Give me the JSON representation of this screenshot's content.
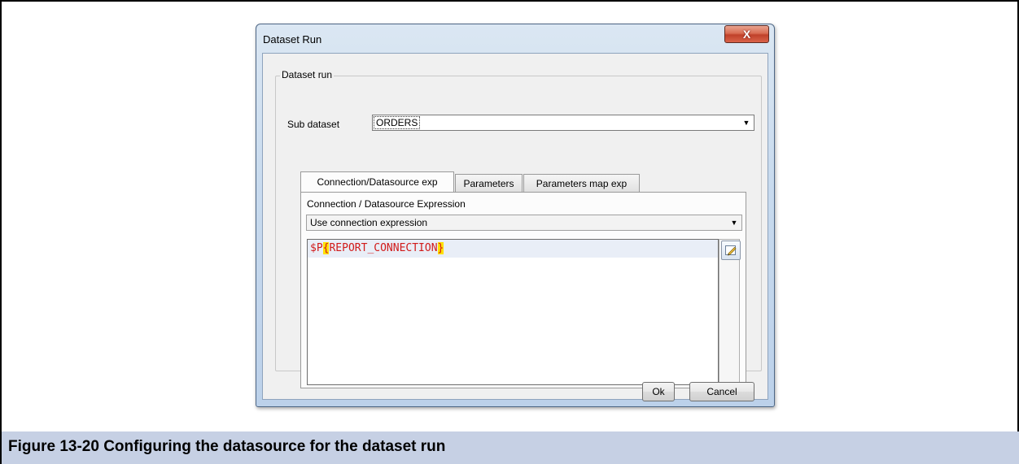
{
  "dialog": {
    "title": "Dataset Run",
    "close_glyph": "X"
  },
  "group": {
    "label": "Dataset run"
  },
  "sub_dataset": {
    "label": "Sub dataset",
    "value": "ORDERS"
  },
  "tabs": [
    {
      "label": "Connection/Datasource exp",
      "active": true
    },
    {
      "label": "Parameters",
      "active": false
    },
    {
      "label": "Parameters map exp",
      "active": false
    }
  ],
  "connection": {
    "label": "Connection / Datasource Expression",
    "mode": "Use connection expression",
    "expression_prefix": "$P",
    "expression_open": "{",
    "expression_body": "REPORT_CONNECTION",
    "expression_close": "}"
  },
  "buttons": {
    "ok": "Ok",
    "cancel": "Cancel"
  },
  "caption": "Figure 13-20  Configuring the datasource for the dataset run",
  "icons": {
    "close": "close-icon",
    "dropdown": "chevron-down-icon",
    "edit": "pencil-edit-icon"
  },
  "colors": {
    "caption_bg": "#c6d0e4",
    "expression_text": "#d11a1a",
    "brace_highlight": "#ffe000"
  }
}
